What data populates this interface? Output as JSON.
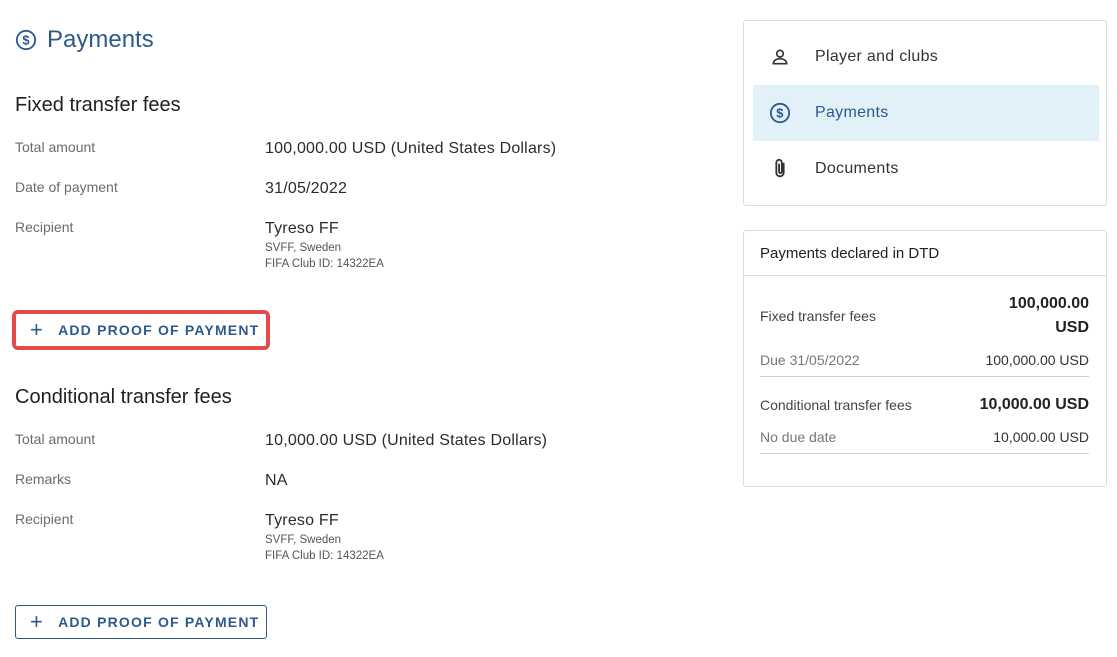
{
  "page": {
    "title": "Payments"
  },
  "fixed": {
    "title": "Fixed transfer fees",
    "total_amount_label": "Total amount",
    "total_amount_value": "100,000.00 USD (United States Dollars)",
    "date_label": "Date of payment",
    "date_value": "31/05/2022",
    "recipient_label": "Recipient",
    "recipient_name": "Tyreso FF",
    "recipient_assoc": "SVFF, Sweden",
    "recipient_id": "FIFA Club ID: 14322EA",
    "button_label": "ADD PROOF OF PAYMENT"
  },
  "conditional": {
    "title": "Conditional transfer fees",
    "total_amount_label": "Total amount",
    "total_amount_value": "10,000.00 USD (United States Dollars)",
    "remarks_label": "Remarks",
    "remarks_value": "NA",
    "recipient_label": "Recipient",
    "recipient_name": "Tyreso FF",
    "recipient_assoc": "SVFF, Sweden",
    "recipient_id": "FIFA Club ID: 14322EA",
    "button_label": "ADD PROOF OF PAYMENT"
  },
  "nav": {
    "items": [
      {
        "label": "Player and clubs",
        "icon": "person-icon",
        "active": false
      },
      {
        "label": "Payments",
        "icon": "dollar-circle-icon",
        "active": true
      },
      {
        "label": "Documents",
        "icon": "paperclip-icon",
        "active": false
      }
    ]
  },
  "summary": {
    "title": "Payments declared in DTD",
    "fixed_label": "Fixed transfer fees",
    "fixed_total_line1": "100,000.00",
    "fixed_total_line2": "USD",
    "fixed_due_label": "Due 31/05/2022",
    "fixed_due_value": "100,000.00 USD",
    "conditional_label": "Conditional transfer fees",
    "conditional_total": "10,000.00 USD",
    "conditional_due_label": "No due date",
    "conditional_due_value": "10,000.00 USD"
  },
  "colors": {
    "accent": "#2c5a8c",
    "active_bg": "#e2f0f8",
    "highlight": "#e24a4a"
  }
}
